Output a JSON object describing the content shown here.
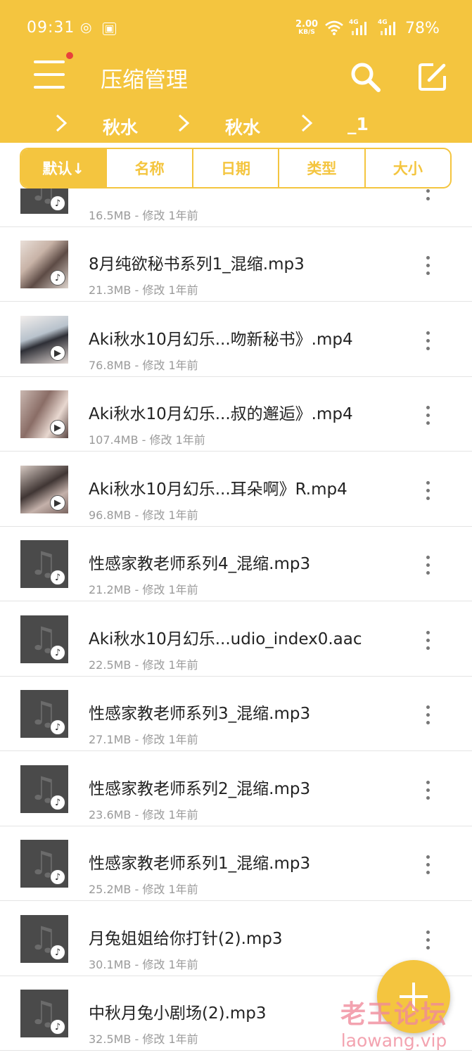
{
  "status_bar": {
    "time": "09:31",
    "speed_value": "2.00",
    "speed_unit": "KB/S",
    "network_1": "4G",
    "network_2": "4G",
    "battery": "78%"
  },
  "toolbar": {
    "title": "压缩管理",
    "menu_icon": "hamburger-menu-icon",
    "search_icon": "search-icon",
    "edit_icon": "edit-icon"
  },
  "breadcrumb": [
    "秋水",
    "秋水",
    "_1"
  ],
  "sort_tabs": [
    "默认↓",
    "名称",
    "日期",
    "类型",
    "大小"
  ],
  "files": [
    {
      "name": "",
      "meta": "16.5MB - 修改 1年前",
      "type": "audio",
      "thumb": "dark"
    },
    {
      "name": "8月纯欲秘书系列1_混缩.mp3",
      "meta": "21.3MB - 修改 1年前",
      "type": "audio",
      "thumb": "pic"
    },
    {
      "name": "Aki秋水10月幻乐...吻新秘书》.mp4",
      "meta": "76.8MB - 修改 1年前",
      "type": "video",
      "thumb": "pic2"
    },
    {
      "name": "Aki秋水10月幻乐...叔的邂逅》.mp4",
      "meta": "107.4MB - 修改 1年前",
      "type": "video",
      "thumb": "pic3"
    },
    {
      "name": "Aki秋水10月幻乐...耳朵啊》R.mp4",
      "meta": "96.8MB - 修改 1年前",
      "type": "video",
      "thumb": "pic4"
    },
    {
      "name": "性感家教老师系列4_混缩.mp3",
      "meta": "21.2MB - 修改 1年前",
      "type": "audio",
      "thumb": "dark"
    },
    {
      "name": "Aki秋水10月幻乐...udio_index0.aac",
      "meta": "22.5MB - 修改 1年前",
      "type": "audio",
      "thumb": "dark"
    },
    {
      "name": "性感家教老师系列3_混缩.mp3",
      "meta": "27.1MB - 修改 1年前",
      "type": "audio",
      "thumb": "dark"
    },
    {
      "name": "性感家教老师系列2_混缩.mp3",
      "meta": "23.6MB - 修改 1年前",
      "type": "audio",
      "thumb": "dark"
    },
    {
      "name": "性感家教老师系列1_混缩.mp3",
      "meta": "25.2MB - 修改 1年前",
      "type": "audio",
      "thumb": "dark"
    },
    {
      "name": "月兔姐姐给你打针(2).mp3",
      "meta": "30.1MB - 修改 1年前",
      "type": "audio",
      "thumb": "dark"
    },
    {
      "name": "中秋月兔小剧场(2).mp3",
      "meta": "32.5MB - 修改 1年前",
      "type": "audio",
      "thumb": "dark"
    }
  ],
  "fab_icon": "add-icon",
  "watermark": {
    "line1": "老王论坛",
    "line2": "laowang.vip"
  },
  "colors": {
    "accent": "#f4c53f",
    "text": "#222222",
    "meta": "#9a9a9a"
  }
}
